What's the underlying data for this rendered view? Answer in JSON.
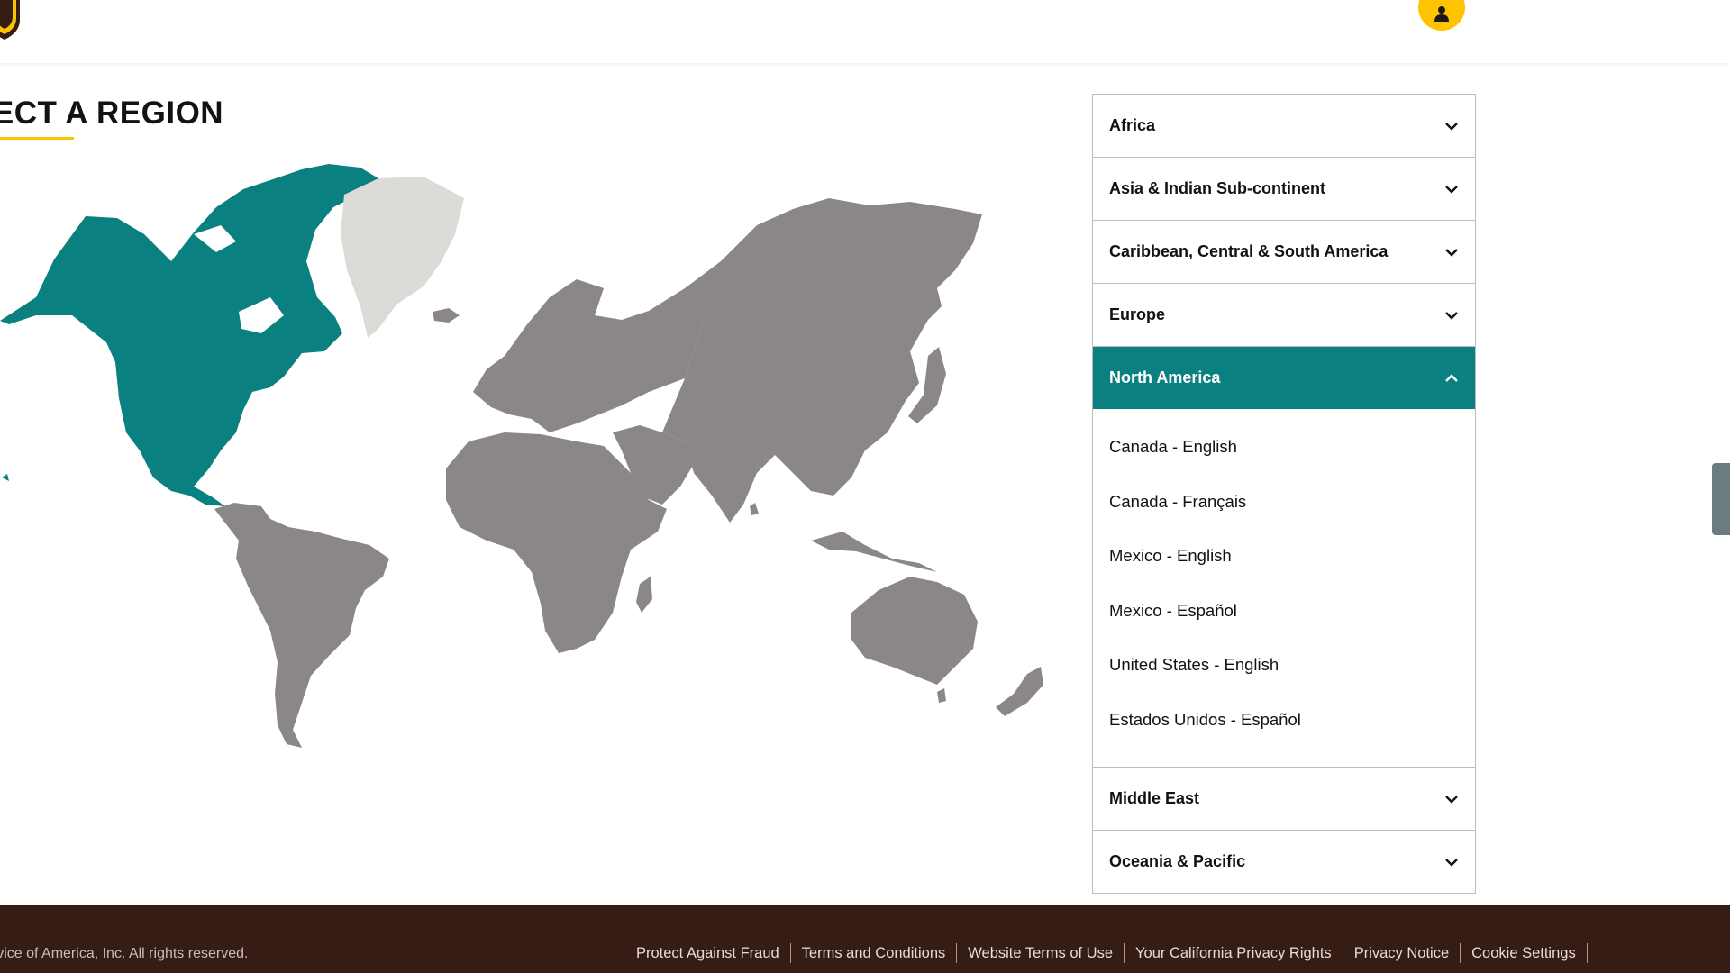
{
  "header": {
    "logo_icon": "ups-shield-logo",
    "account_icon": "user-icon",
    "brand_color": "#ffc400"
  },
  "page": {
    "title": "LECT A REGION"
  },
  "map": {
    "highlighted_region": "North America",
    "highlight_color": "#0a8080",
    "default_color": "#8b8787",
    "inactive_color": "#dddbd8"
  },
  "regions": [
    {
      "label": "Africa",
      "expanded": false
    },
    {
      "label": "Asia & Indian Sub-continent",
      "expanded": false
    },
    {
      "label": "Caribbean, Central & South America",
      "expanded": false
    },
    {
      "label": "Europe",
      "expanded": false
    },
    {
      "label": "North America",
      "expanded": true,
      "links": [
        "Canada - English",
        "Canada - Français",
        "Mexico - English",
        "Mexico - Español",
        "United States - English",
        "Estados Unidos - Español"
      ]
    },
    {
      "label": "Middle East",
      "expanded": false
    },
    {
      "label": "Oceania & Pacific",
      "expanded": false
    }
  ],
  "footer": {
    "copyright": "ervice of America, Inc. All rights reserved.",
    "links": [
      "Protect Against Fraud",
      "Terms and Conditions",
      "Website Terms of Use",
      "Your California Privacy Rights",
      "Privacy Notice",
      "Cookie Settings"
    ],
    "background": "#351c15"
  }
}
